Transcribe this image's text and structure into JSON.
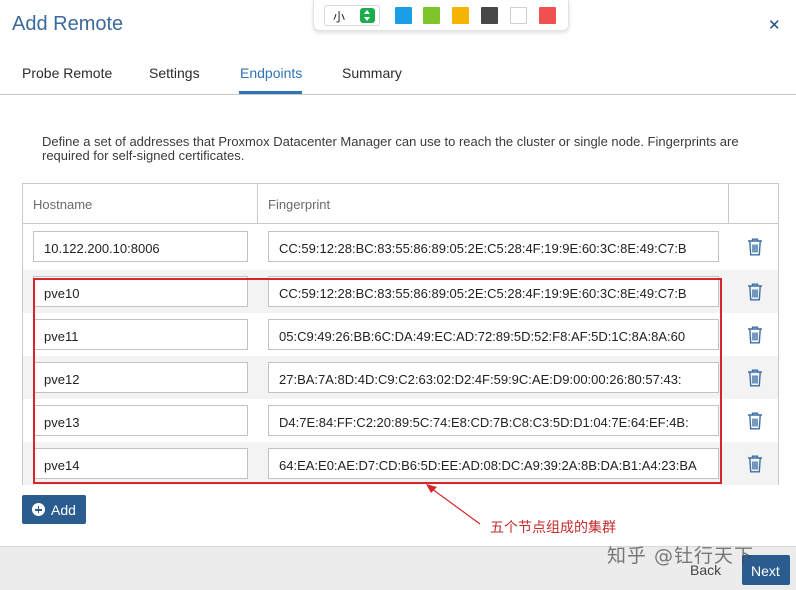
{
  "dialog": {
    "title": "Add Remote",
    "close_icon": "close-x-icon"
  },
  "annotation_toolbar": {
    "size_label": "小",
    "colors": [
      "#1a9ee6",
      "#7ec42a",
      "#f4b400",
      "#474747",
      "#ffffff",
      "#f05050"
    ]
  },
  "tabs": [
    {
      "label": "Probe Remote",
      "active": false
    },
    {
      "label": "Settings",
      "active": false
    },
    {
      "label": "Endpoints",
      "active": true
    },
    {
      "label": "Summary",
      "active": false
    }
  ],
  "description": "Define a set of addresses that Proxmox Datacenter Manager can use to reach the cluster or single node. Fingerprints are required for self-signed certificates.",
  "table": {
    "columns": [
      "Hostname",
      "Fingerprint"
    ],
    "rows": [
      {
        "hostname": "10.122.200.10:8006",
        "fingerprint": "CC:59:12:28:BC:83:55:86:89:05:2E:C5:28:4F:19:9E:60:3C:8E:49:C7:B"
      },
      {
        "hostname": "pve10",
        "fingerprint": "CC:59:12:28:BC:83:55:86:89:05:2E:C5:28:4F:19:9E:60:3C:8E:49:C7:B"
      },
      {
        "hostname": "pve11",
        "fingerprint": "05:C9:49:26:BB:6C:DA:49:EC:AD:72:89:5D:52:F8:AF:5D:1C:8A:8A:60"
      },
      {
        "hostname": "pve12",
        "fingerprint": "27:BA:7A:8D:4D:C9:C2:63:02:D2:4F:59:9C:AE:D9:00:00:26:80:57:43:"
      },
      {
        "hostname": "pve13",
        "fingerprint": "D4:7E:84:FF:C2:20:89:5C:74:E8:CD:7B:C8:C3:5D:D1:04:7E:64:EF:4B:"
      },
      {
        "hostname": "pve14",
        "fingerprint": "64:EA:E0:AE:D7:CD:B6:5D:EE:AD:08:DC:A9:39:2A:8B:DA:B1:A4:23:BA"
      }
    ]
  },
  "buttons": {
    "add": "Add",
    "back": "Back",
    "next": "Next"
  },
  "annotation": {
    "text": "五个节点组成的集群",
    "color": "#d6262b"
  },
  "watermark": "知乎 @钍行天下",
  "colors": {
    "accent": "#2f74b5",
    "button": "#2b5c8f",
    "title": "#3b6a9c"
  }
}
